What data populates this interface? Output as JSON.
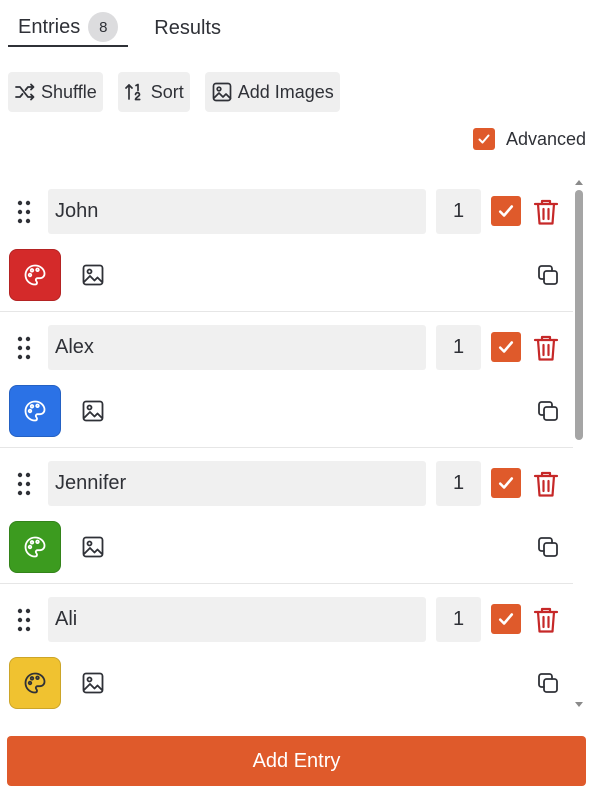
{
  "tabs": {
    "entries_label": "Entries",
    "entries_count": "8",
    "results_label": "Results"
  },
  "toolbar": {
    "shuffle_label": "Shuffle",
    "sort_label": "Sort",
    "add_images_label": "Add Images"
  },
  "advanced": {
    "label": "Advanced",
    "checked": true
  },
  "entries": [
    {
      "name": "John",
      "weight": "1",
      "enabled": true,
      "color": "#d42a2a"
    },
    {
      "name": "Alex",
      "weight": "1",
      "enabled": true,
      "color": "#2b72e6"
    },
    {
      "name": "Jennifer",
      "weight": "1",
      "enabled": true,
      "color": "#3c9b1f"
    },
    {
      "name": "Ali",
      "weight": "1",
      "enabled": true,
      "color": "#f0c230"
    }
  ],
  "add_entry_label": "Add Entry",
  "colors": {
    "accent": "#df5a2b",
    "danger": "#c62828",
    "field_bg": "#f0f0f0"
  },
  "icons": {
    "shuffle": "shuffle-icon",
    "sort": "sort-numeric-icon",
    "add_images": "image-icon",
    "drag": "drag-handle-icon",
    "check": "checkmark-icon",
    "delete": "trash-icon",
    "palette": "palette-icon",
    "image": "image-icon",
    "duplicate": "copy-icon"
  }
}
